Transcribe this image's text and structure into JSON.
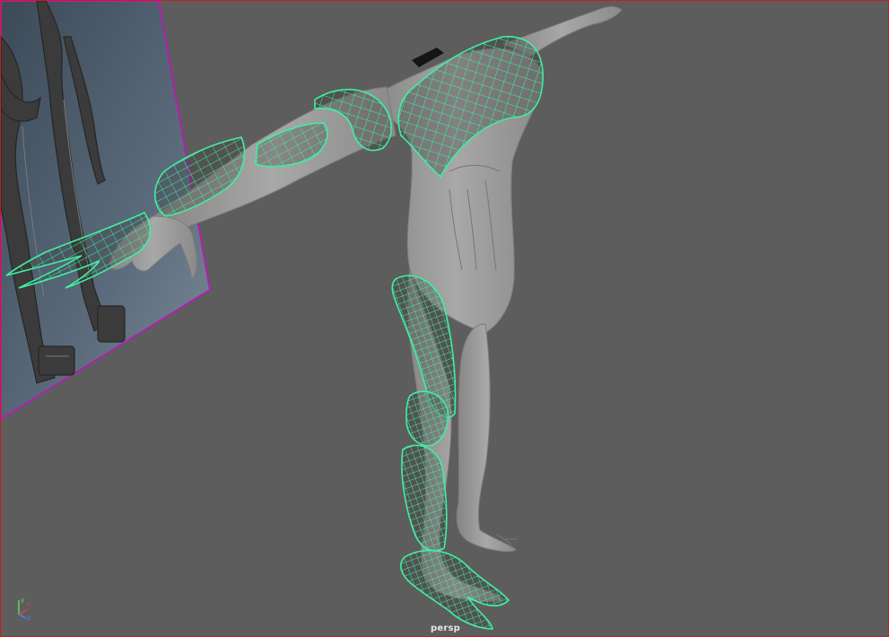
{
  "viewport": {
    "camera_name": "persp",
    "border_color": "#c81e1e",
    "background_color": "#5d5d5d"
  },
  "image_plane": {
    "content": "robot-reference-image",
    "border_color": "#b020b0"
  },
  "model": {
    "base_mesh_color": "#9c9c9c",
    "wireframe_color": "#3ff0a0",
    "wireframe_style": "selected-wireframe-on-shaded"
  },
  "axis_gizmo": {
    "x_color": "#e04040",
    "y_color": "#60e060",
    "z_color": "#5a7bff",
    "x_label": "x",
    "y_label": "y",
    "z_label": "z"
  }
}
